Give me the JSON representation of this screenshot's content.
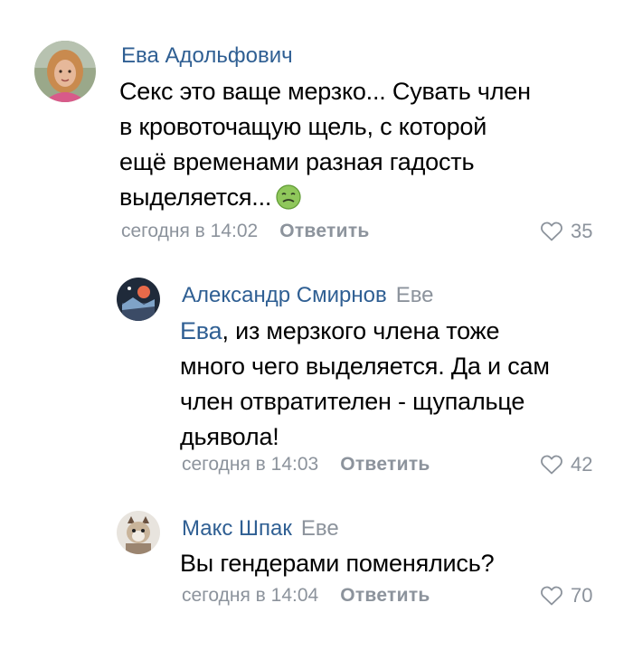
{
  "comments": [
    {
      "author": "Ева Адольфович",
      "reply_to": "",
      "mention": "",
      "lines": [
        "Секс это ваще мерзко... Сувать член",
        "в кровоточащую щель, с которой",
        "ещё временами разная гадость",
        "выделяется..."
      ],
      "emoji": "nauseated-face-emoji",
      "time": "сегодня в 14:02",
      "reply_label": "Ответить",
      "likes": "35"
    },
    {
      "author": "Александр Смирнов",
      "reply_to": "Еве",
      "mention": "Ева",
      "lines": [
        ", из мерзкого члена тоже",
        "много чего выделяется. Да и сам",
        "член отвратителен - щупальце",
        "дьявола!"
      ],
      "time": "сегодня в 14:03",
      "reply_label": "Ответить",
      "likes": "42"
    },
    {
      "author": "Макс Шпак",
      "reply_to": "Еве",
      "mention": "",
      "lines": [
        "Вы гендерами поменялись?"
      ],
      "time": "сегодня в 14:04",
      "reply_label": "Ответить",
      "likes": "70"
    }
  ],
  "colors": {
    "author": "#2f5f93",
    "secondary": "#8c939c",
    "text": "#000000"
  },
  "icons": {
    "like": "heart-outline-icon"
  }
}
